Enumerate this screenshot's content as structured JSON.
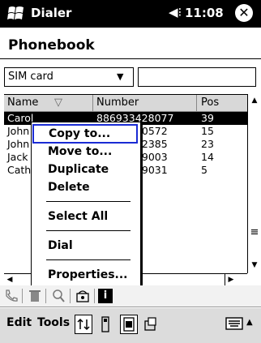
{
  "titlebar": {
    "app_title": "Dialer",
    "time": "11:08",
    "close_glyph": "✕",
    "speaker_glyph": "◀⁝"
  },
  "page": {
    "title": "Phonebook"
  },
  "filter": {
    "source_value": "SIM card",
    "dropdown_arrow": "▼",
    "search_value": ""
  },
  "list": {
    "columns": [
      "Name",
      "Number",
      "Pos"
    ],
    "sort_indicator": "▽",
    "rows": [
      {
        "name": "Carol",
        "number": "886933428077",
        "pos": "39",
        "selected": true
      },
      {
        "name": "John",
        "number": "210572",
        "pos": "15"
      },
      {
        "name": "John",
        "number": "412385",
        "pos": "23"
      },
      {
        "name": "Jack",
        "number": "329003",
        "pos": "14"
      },
      {
        "name": "Cath",
        "number": "539031",
        "pos": "5"
      }
    ]
  },
  "context_menu": {
    "items": [
      "Copy to...",
      "Move to...",
      "Duplicate",
      "Delete",
      "Select All",
      "Dial",
      "Properties..."
    ],
    "focused": "Copy to..."
  },
  "scrollbar": {
    "up": "▲",
    "down": "▼",
    "left": "◀",
    "right": "▶",
    "grip": "≡"
  },
  "toolbar": {
    "icons": [
      "phone-icon",
      "delete-icon",
      "find-contact-icon",
      "dial-icon",
      "info-icon"
    ],
    "info_label": "i"
  },
  "menubar": {
    "edit": "Edit",
    "tools": "Tools",
    "keyboard_arrow": "▲"
  },
  "colors": {
    "title_bg": "#000000",
    "selection_bg": "#000000",
    "focus_outline": "#1a2bd4",
    "menubar_bg": "#dcdcdc"
  }
}
